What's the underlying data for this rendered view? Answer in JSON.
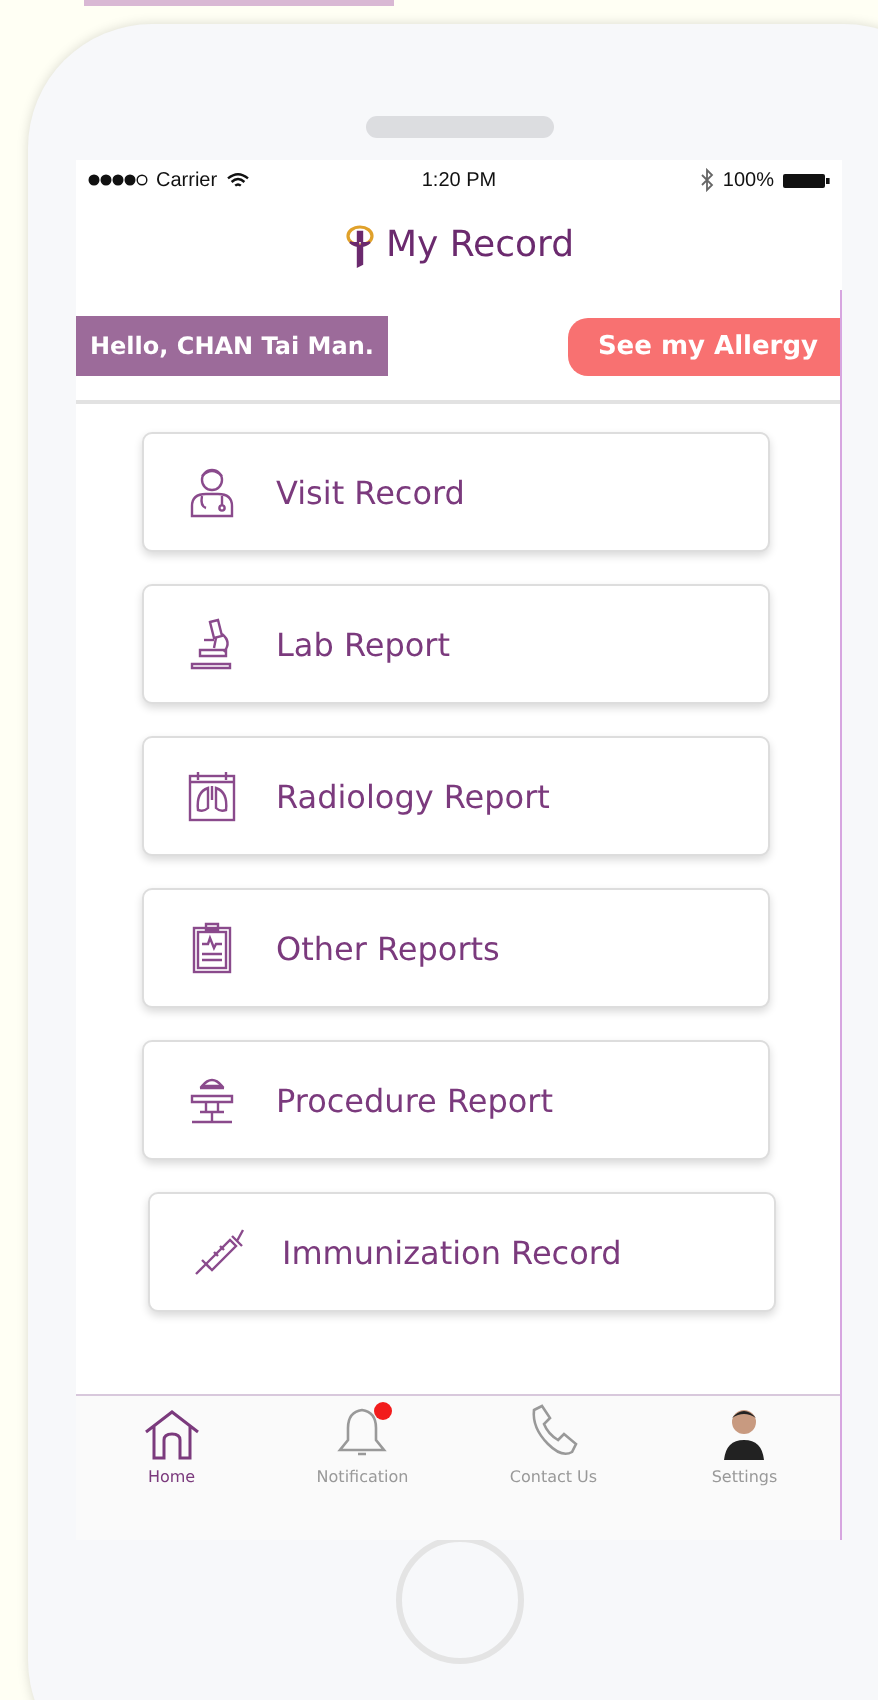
{
  "status_bar": {
    "carrier": "Carrier",
    "time": "1:20 PM",
    "battery": "100%"
  },
  "header": {
    "title": "My Record"
  },
  "greeting": "Hello, CHAN Tai Man.",
  "allergy_button": "See my Allergy",
  "menu": [
    {
      "label": "Visit Record",
      "kind": "doctor"
    },
    {
      "label": "Lab Report",
      "kind": "microscope"
    },
    {
      "label": "Radiology Report",
      "kind": "xray"
    },
    {
      "label": "Other Reports",
      "kind": "clipboard"
    },
    {
      "label": "Procedure Report",
      "kind": "table"
    },
    {
      "label": "Immunization Record",
      "kind": "syringe"
    }
  ],
  "tab_bar": [
    {
      "label": "Home",
      "kind": "home",
      "selected": true,
      "badge": false
    },
    {
      "label": "Notification",
      "kind": "bell",
      "selected": false,
      "badge": true
    },
    {
      "label": "Contact Us",
      "kind": "phone",
      "selected": false,
      "badge": false
    },
    {
      "label": "Settings",
      "kind": "avatar",
      "selected": false,
      "badge": false
    }
  ]
}
